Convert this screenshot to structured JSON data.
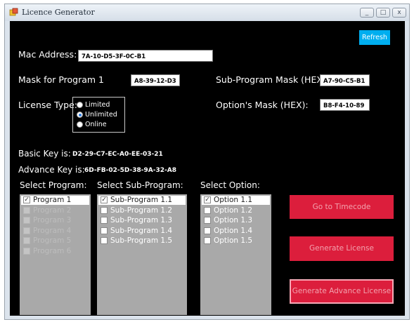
{
  "window": {
    "title": "Licence Generator",
    "controls": {
      "minimize": "_",
      "maximize": "□",
      "close": "x"
    }
  },
  "refresh_label": "Refresh",
  "mac": {
    "label": "Mac Address:",
    "value": "7A-10-D5-3F-0C-B1"
  },
  "mask_program": {
    "label": "Mask for Program 1",
    "value": "A8-39-12-D3"
  },
  "sub_program_mask": {
    "label": "Sub-Program Mask (HEX):",
    "value": "A7-90-C5-B1"
  },
  "options_mask": {
    "label": "Option's Mask (HEX):",
    "value": "B8-F4-10-89"
  },
  "license_type": {
    "label": "License Type:",
    "options": [
      {
        "label": "Limited",
        "selected": false
      },
      {
        "label": "Unlimited",
        "selected": true
      },
      {
        "label": "Online",
        "selected": false
      }
    ]
  },
  "basic_key": {
    "label": "Basic Key is:",
    "value": "D2-29-C7-EC-A0-EE-03-21"
  },
  "advance_key": {
    "label": "Advance Key is:",
    "value": "6D-FB-02-5D-38-9A-32-A8"
  },
  "programs": {
    "label": "Select Program:",
    "items": [
      {
        "label": "Program 1",
        "checked": true
      },
      {
        "label": "Program 2",
        "checked": false
      },
      {
        "label": "Program 3",
        "checked": false
      },
      {
        "label": "Program 4",
        "checked": false
      },
      {
        "label": "Program 5",
        "checked": false
      },
      {
        "label": "Program 6",
        "checked": false
      }
    ]
  },
  "sub_programs": {
    "label": "Select Sub-Program:",
    "items": [
      {
        "label": "Sub-Program 1.1",
        "checked": true
      },
      {
        "label": "Sub-Program 1.2",
        "checked": false
      },
      {
        "label": "Sub-Program 1.3",
        "checked": false
      },
      {
        "label": "Sub-Program 1.4",
        "checked": false
      },
      {
        "label": "Sub-Program 1.5",
        "checked": false
      }
    ]
  },
  "options": {
    "label": "Select Option:",
    "items": [
      {
        "label": "Option 1.1",
        "checked": true
      },
      {
        "label": "Option 1.2",
        "checked": false
      },
      {
        "label": "Option 1.3",
        "checked": false
      },
      {
        "label": "Option 1.4",
        "checked": false
      },
      {
        "label": "Option 1.5",
        "checked": false
      }
    ]
  },
  "buttons": {
    "goto_timecode": "Go to Timecode",
    "generate_license": "Generate License",
    "generate_advance_license": "Generate Advance License"
  },
  "colors": {
    "client_background": "#000000",
    "refresh": "#00aeef",
    "button": "#dc1e3c",
    "button_text": "#f2a2ae",
    "listbox": "#a9a9a9"
  },
  "icons": {
    "app": "app-icon"
  }
}
